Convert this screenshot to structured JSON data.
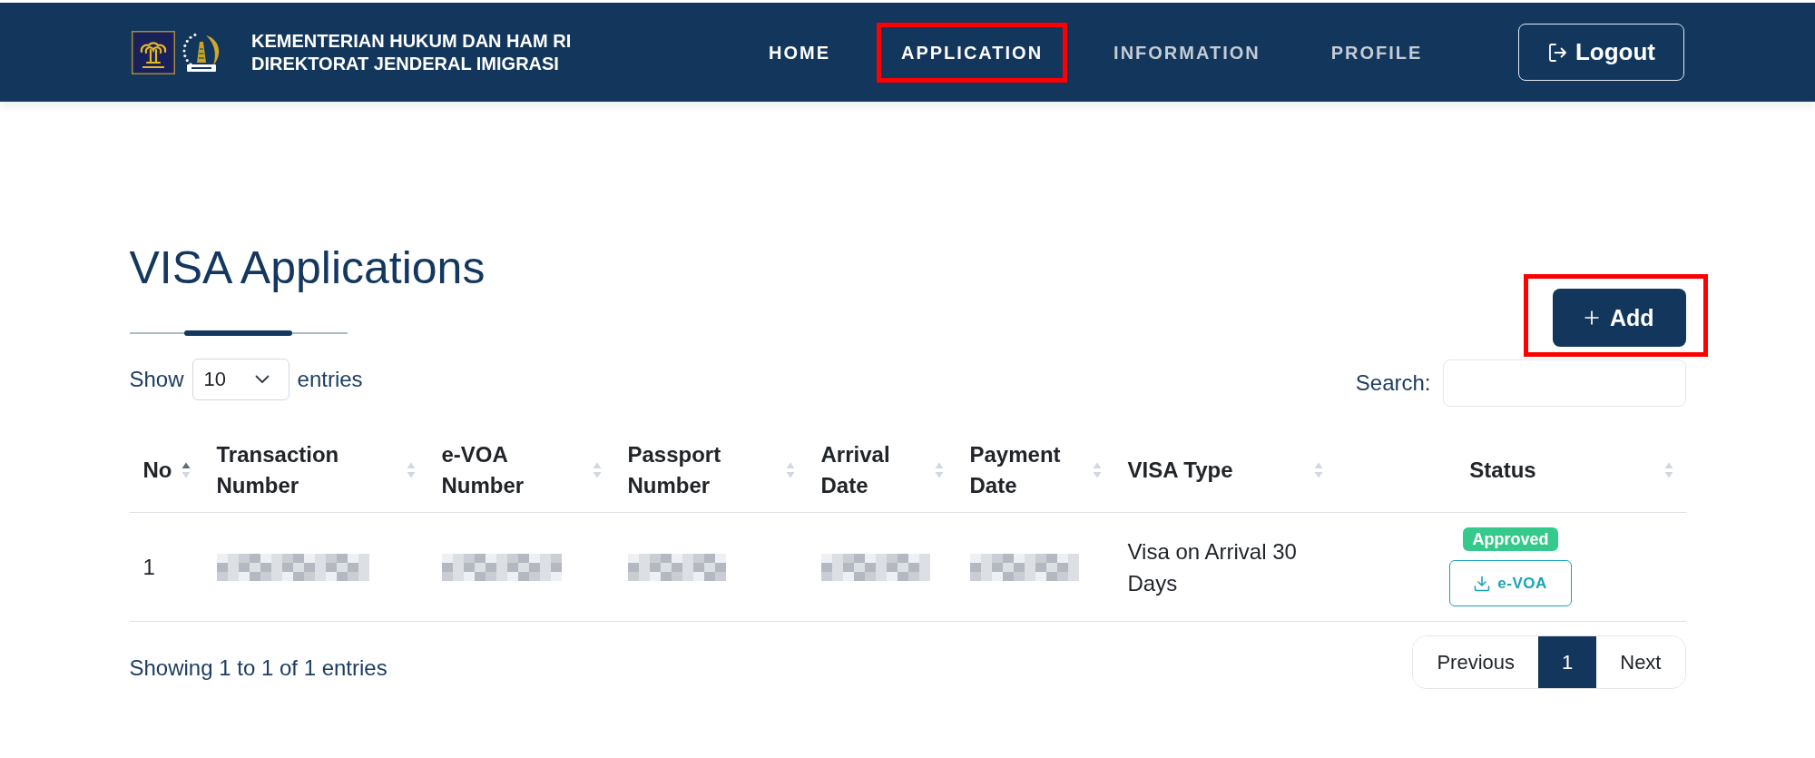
{
  "header": {
    "ministry": "KEMENTERIAN HUKUM DAN HAM RI",
    "directorate": "DIREKTORAT JENDERAL IMIGRASI",
    "nav": [
      {
        "label": "HOME",
        "dimmed": false,
        "highlighted": false
      },
      {
        "label": "APPLICATION",
        "dimmed": false,
        "highlighted": true
      },
      {
        "label": "INFORMATION",
        "dimmed": true,
        "highlighted": false
      },
      {
        "label": "PROFILE",
        "dimmed": true,
        "highlighted": false
      }
    ],
    "logout_button": {
      "label": "Logout"
    }
  },
  "page": {
    "title": "VISA Applications",
    "add_button": {
      "label": "Add",
      "highlighted": true
    }
  },
  "length_menu": {
    "before": "Show",
    "value": "10",
    "after": "entries"
  },
  "search": {
    "label": "Search:"
  },
  "table": {
    "columns": [
      {
        "label": "No",
        "kind": "text",
        "sorted": true
      },
      {
        "label": "Transaction Number",
        "kind": "text",
        "sorted": false
      },
      {
        "label": "e-VOA Number",
        "kind": "text",
        "sorted": false
      },
      {
        "label": "Passport Number",
        "kind": "text",
        "sorted": false
      },
      {
        "label": "Arrival Date",
        "kind": "text",
        "sorted": false
      },
      {
        "label": "Payment Date",
        "kind": "text",
        "sorted": false
      },
      {
        "label": "VISA Type",
        "kind": "text",
        "sorted": false
      },
      {
        "label": "Status",
        "kind": "status",
        "sorted": false
      }
    ],
    "rows": [
      {
        "cells": [
          {
            "kind": "text",
            "text": "1"
          },
          {
            "kind": "redacted"
          },
          {
            "kind": "redacted"
          },
          {
            "kind": "redacted"
          },
          {
            "kind": "redacted"
          },
          {
            "kind": "redacted"
          },
          {
            "kind": "text",
            "text": "Visa on Arrival 30 Days"
          },
          {
            "kind": "status",
            "badge": "Approved",
            "action": "e-VOA"
          }
        ]
      }
    ]
  },
  "footer": {
    "info": "Showing 1 to 1 of 1 entries",
    "pagination": [
      {
        "label": "Previous",
        "selected": false
      },
      {
        "label": "1",
        "selected": true
      },
      {
        "label": "Next",
        "selected": false
      }
    ]
  }
}
